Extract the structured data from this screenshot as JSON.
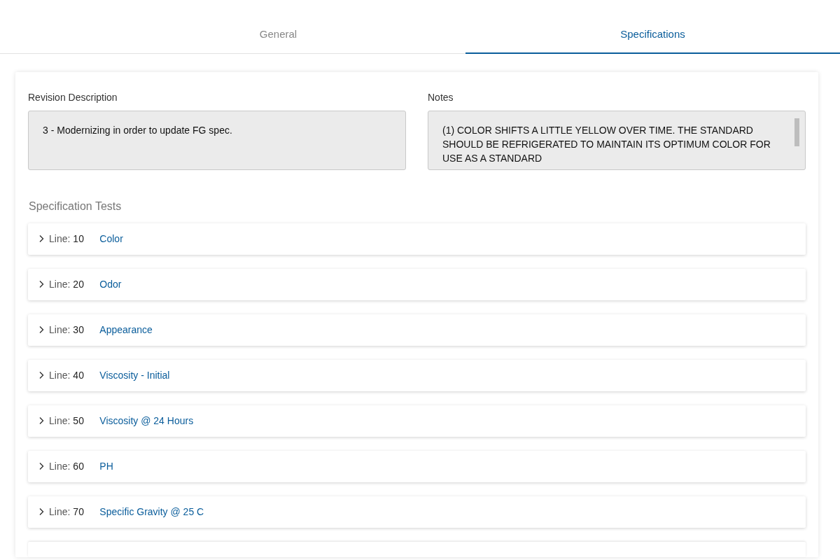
{
  "tabs": [
    {
      "label": "General",
      "selected": false
    },
    {
      "label": "Specifications",
      "selected": true
    }
  ],
  "revision_description": {
    "label": "Revision Description",
    "value": "3 - Modernizing in order to update FG spec."
  },
  "notes": {
    "label": "Notes",
    "value": "(1) COLOR SHIFTS A LITTLE YELLOW OVER TIME. THE STANDARD SHOULD BE REFRIGERATED TO MAINTAIN ITS OPTIMUM COLOR FOR USE AS A STANDARD"
  },
  "specification_tests": {
    "title": "Specification Tests",
    "rows": [
      {
        "line_label": "Line:",
        "line": "10",
        "name": "Color",
        "expanded": false
      },
      {
        "line_label": "Line:",
        "line": "20",
        "name": "Odor",
        "expanded": false
      },
      {
        "line_label": "Line:",
        "line": "30",
        "name": "Appearance",
        "expanded": false
      },
      {
        "line_label": "Line:",
        "line": "40",
        "name": "Viscosity - Initial",
        "expanded": false
      },
      {
        "line_label": "Line:",
        "line": "50",
        "name": "Viscosity @ 24 Hours",
        "expanded": false
      },
      {
        "line_label": "Line:",
        "line": "60",
        "name": "PH",
        "expanded": false
      },
      {
        "line_label": "Line:",
        "line": "70",
        "name": "Specific Gravity @ 25 C",
        "expanded": false
      }
    ]
  }
}
